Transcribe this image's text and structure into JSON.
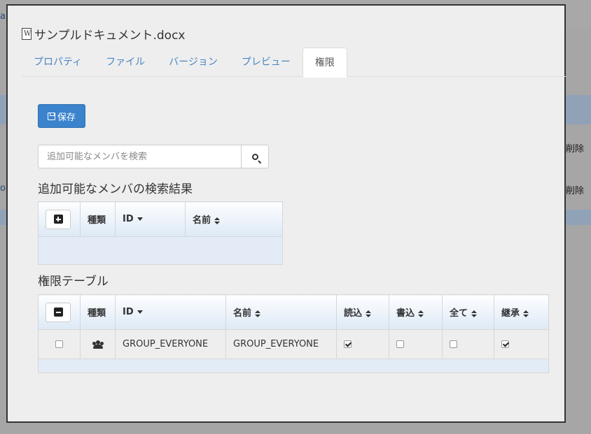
{
  "background": {
    "delete_label_1": "削除",
    "delete_label_2": "削除",
    "left_fragment_1": "ar",
    "left_fragment_2": "oc"
  },
  "modal": {
    "title": "サンプルドキュメント.docx",
    "tabs": [
      "プロパティ",
      "ファイル",
      "バージョン",
      "プレビュー",
      "権限"
    ],
    "active_tab_index": 4,
    "save_label": "保存",
    "search": {
      "placeholder": "追加可能なメンバを検索",
      "value": ""
    },
    "search_results_title": "追加可能なメンバの検索結果",
    "search_table": {
      "headers": [
        "種類",
        "ID",
        "名前"
      ],
      "rows": []
    },
    "permission_title": "権限テーブル",
    "permission_table": {
      "headers": [
        "種類",
        "ID",
        "名前",
        "読込",
        "書込",
        "全て",
        "継承"
      ],
      "rows": [
        {
          "selected": false,
          "type_icon": "users-icon",
          "id": "GROUP_EVERYONE",
          "name": "GROUP_EVERYONE",
          "read": true,
          "write": false,
          "all": false,
          "inherit": true
        }
      ]
    }
  },
  "colors": {
    "primary_button": "#3b83cc",
    "tab_link": "#4a86c5",
    "table_header": "#dde9f6"
  }
}
